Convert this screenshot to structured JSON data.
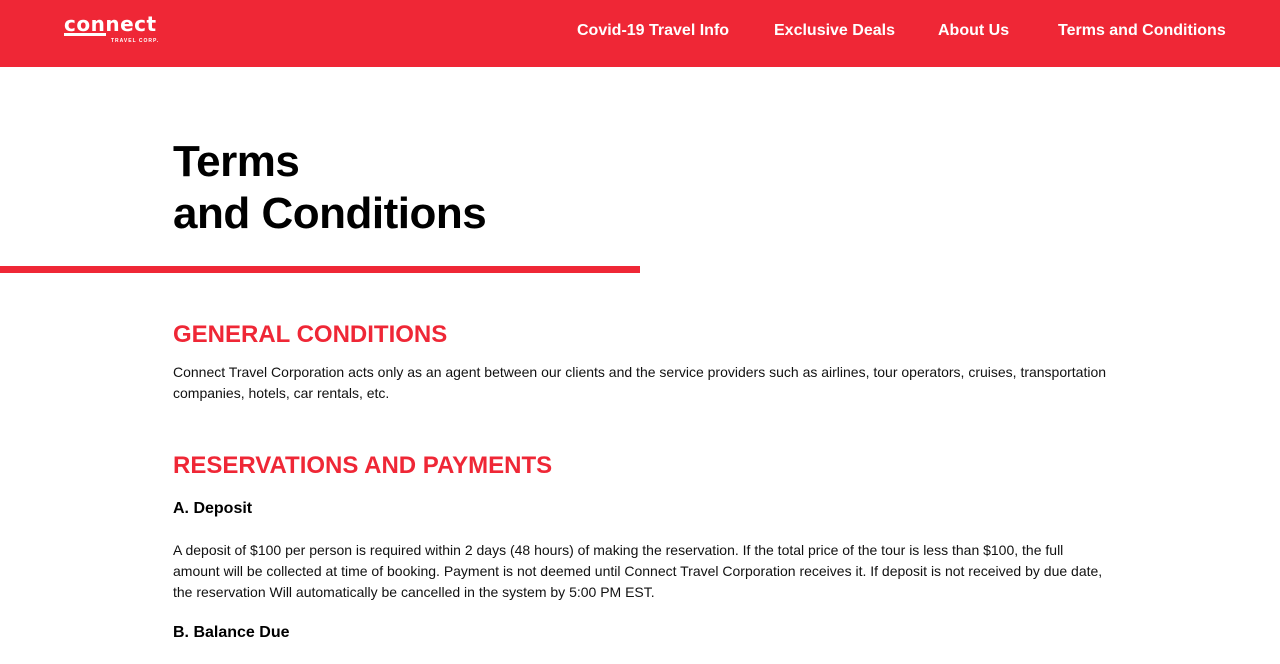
{
  "header": {
    "logo": {
      "main": "connect",
      "sub": "TRAVEL CORP."
    },
    "nav": [
      {
        "label": "Covid-19 Travel Info"
      },
      {
        "label": "Exclusive Deals"
      },
      {
        "label": "About Us"
      },
      {
        "label": "Terms and Conditions"
      }
    ]
  },
  "page": {
    "title_line1": "Terms",
    "title_line2": "and Conditions"
  },
  "sections": {
    "general": {
      "heading": "GENERAL CONDITIONS",
      "body": "Connect Travel Corporation acts only as an agent between our clients and the service providers such as airlines, tour operators, cruises, transportation companies, hotels, car rentals, etc."
    },
    "reservations": {
      "heading": "RESERVATIONS AND PAYMENTS",
      "deposit_heading": "A. Deposit",
      "deposit_body": "A deposit of $100 per person is required within 2 days (48 hours) of making the reservation. If the total price of the tour is less than $100, the full amount will be collected at time of booking. Payment is not deemed until Connect Travel Corporation receives it. If deposit is not received by due date, the reservation Will automatically be cancelled in the system by 5:00 PM EST.",
      "balance_heading": "B. Balance Due"
    }
  },
  "colors": {
    "accent": "#ef2736"
  }
}
